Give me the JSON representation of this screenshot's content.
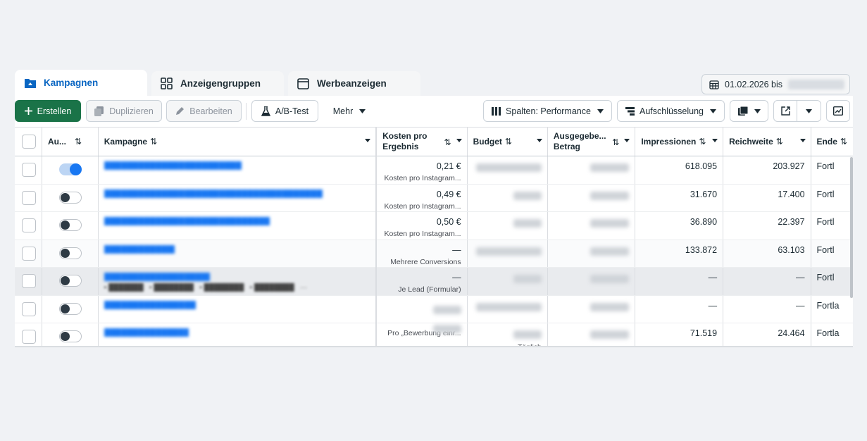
{
  "tabs": [
    {
      "label": "Kampagnen",
      "icon": "folder-icon",
      "active": true
    },
    {
      "label": "Anzeigengruppen",
      "icon": "grid-icon",
      "active": false
    },
    {
      "label": "Werbeanzeigen",
      "icon": "window-icon",
      "active": false
    }
  ],
  "date_range": {
    "label": "01.02.2026 bis",
    "icon": "calendar-icon"
  },
  "toolbar": {
    "create": "Erstellen",
    "duplicate": "Duplizieren",
    "edit": "Bearbeiten",
    "ab_test": "A/B-Test",
    "more": "Mehr",
    "columns": "Spalten: Performance",
    "breakdown": "Aufschlüsselung"
  },
  "columns": {
    "status": "Au...",
    "campaign": "Kampagne",
    "cost_per_result_1": "Kosten pro",
    "cost_per_result_2": "Ergebnis",
    "budget": "Budget",
    "spent_1": "Ausgegebe...",
    "spent_2": "Betrag",
    "impressions": "Impressionen",
    "reach": "Reichweite",
    "end": "Ende"
  },
  "sort_glyph": "⇅",
  "rows": [
    {
      "status_on": true,
      "cost": "0,21 €",
      "cost_sub": "Kosten pro Instagram...",
      "impressions": "618.095",
      "reach": "203.927",
      "end": "Fortl",
      "budget_sub": ""
    },
    {
      "status_on": false,
      "cost": "0,49 €",
      "cost_sub": "Kosten pro Instagram...",
      "impressions": "31.670",
      "reach": "17.400",
      "end": "Fortl",
      "budget_sub": ""
    },
    {
      "status_on": false,
      "cost": "0,50 €",
      "cost_sub": "Kosten pro Instagram...",
      "impressions": "36.890",
      "reach": "22.397",
      "end": "Fortl",
      "budget_sub": ""
    },
    {
      "status_on": false,
      "cost": "—",
      "cost_sub": "Mehrere Conversions",
      "impressions": "133.872",
      "reach": "63.103",
      "end": "Fortl",
      "budget_sub": ""
    },
    {
      "status_on": false,
      "cost": "—",
      "cost_sub": "Je Lead (Formular)",
      "impressions": "—",
      "reach": "—",
      "end": "Fortl",
      "budget_sub": ""
    },
    {
      "status_on": false,
      "cost": "",
      "cost_sub": "",
      "impressions": "—",
      "reach": "—",
      "end": "Fortla",
      "budget_sub": ""
    },
    {
      "status_on": false,
      "cost": "",
      "cost_sub": "Pro „Bewerbung einr...",
      "impressions": "71.519",
      "reach": "24.464",
      "end": "Fortla",
      "budget_sub": "Täglich"
    }
  ]
}
